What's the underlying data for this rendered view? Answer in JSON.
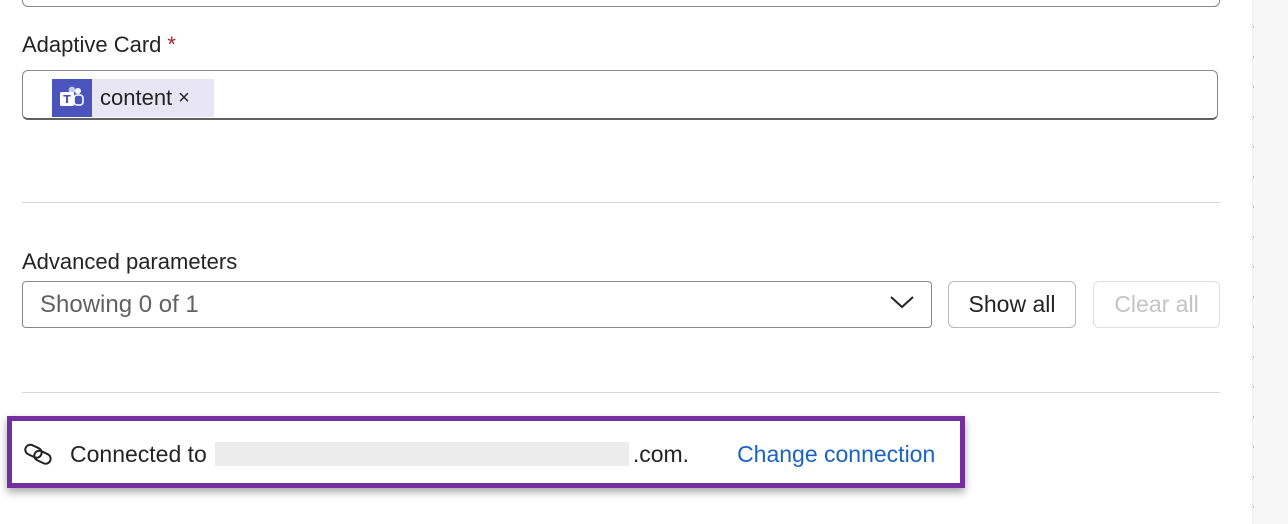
{
  "adaptive_card": {
    "label": "Adaptive Card",
    "required_mark": "*",
    "token": {
      "icon": "teams-icon",
      "text": "content",
      "remove": "×"
    }
  },
  "advanced": {
    "label": "Advanced parameters",
    "select_value": "Showing 0 of 1",
    "show_all": "Show all",
    "clear_all": "Clear all"
  },
  "connection": {
    "icon": "link-icon",
    "prefix": "Connected to",
    "suffix": ".com.",
    "change_link": "Change connection",
    "highlight_color": "#742f9e",
    "link_color": "#1a62c4"
  }
}
